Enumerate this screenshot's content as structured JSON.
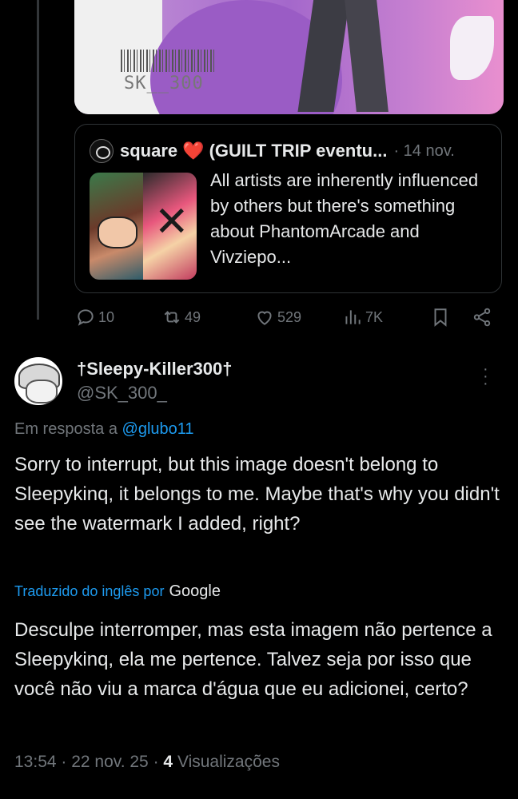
{
  "media": {
    "watermark": "SK__300"
  },
  "quote": {
    "author": "square",
    "heart": "❤️",
    "title_extra": "(GUILT TRIP eventu...",
    "date": "· 14 nov.",
    "text": "All artists are inherently influenced by others but there's something about PhantomArcade and Vivziepo..."
  },
  "actions": {
    "replies": "10",
    "reposts": "49",
    "likes": "529",
    "views": "7K"
  },
  "reply": {
    "display_name": "†Sleepy-Killer300†",
    "handle": "@SK_300_",
    "reply_prefix": "Em resposta a",
    "reply_to": "@glubo11",
    "text": "Sorry to interrupt, but this image doesn't belong to Sleepykinq, it belongs to me. Maybe that's why you didn't see the watermark I added, right?",
    "translated_label": "Traduzido do inglês por",
    "translator": "Google",
    "translation": "Desculpe interromper, mas esta imagem não pertence a Sleepykinq, ela me pertence. Talvez seja por isso que você não viu a marca d'água que eu adicionei, certo?",
    "time": "13:54 · 22 nov. 25 ·",
    "view_count": "4",
    "view_label": "Visualizações"
  }
}
